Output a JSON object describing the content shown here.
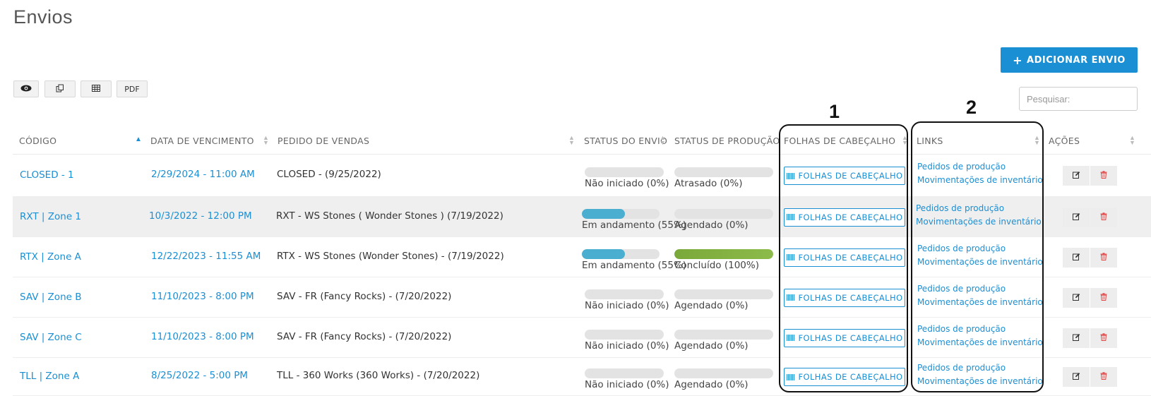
{
  "page": {
    "title": "Envios"
  },
  "toolbar": {
    "add_label": "ADICIONAR ENVIO",
    "add_icon": "plus-icon",
    "pdf_label": "PDF",
    "search_placeholder": "Pesquisar:"
  },
  "columns": {
    "codigo": "CÓDIGO",
    "data": "DATA DE VENCIMENTO",
    "pedido": "PEDIDO DE VENDAS",
    "status_envio": "STATUS DO ENVIO",
    "status_producao": "STATUS DE PRODUÇÃO",
    "folhas": "FOLHAS DE CABEÇALHO",
    "links": "LINKS",
    "acoes": "AÇÕES"
  },
  "common": {
    "folhas_label": "FOLHAS DE CABEÇALHO",
    "link_pedidos": "Pedidos de produção",
    "link_movimentacoes": "Movimentações de inventário"
  },
  "rows": [
    {
      "code": "CLOSED - 1",
      "date": "2/29/2024 - 11:00 AM",
      "order": "CLOSED - (9/25/2022)",
      "envio_label": "Não iniciado (0%)",
      "envio_pct": 0,
      "prod_label": "Atrasado (0%)",
      "prod_pct": 0
    },
    {
      "code": "RXT | Zone 1",
      "date": "10/3/2022 - 12:00 PM",
      "order": "RXT - WS Stones ( Wonder Stones ) (7/19/2022)",
      "envio_label": "Em andamento (55%)",
      "envio_pct": 55,
      "prod_label": "Agendado (0%)",
      "prod_pct": 0
    },
    {
      "code": "RTX | Zone A",
      "date": "12/22/2023 - 11:55 AM",
      "order": "RTX - WS Stones (Wonder Stones) - (7/19/2022)",
      "envio_label": "Em andamento (55%)",
      "envio_pct": 55,
      "prod_label": "Concluído (100%)",
      "prod_pct": 100
    },
    {
      "code": "SAV | Zone B",
      "date": "11/10/2023 - 8:00 PM",
      "order": "SAV - FR (Fancy Rocks) - (7/20/2022)",
      "envio_label": "Não iniciado (0%)",
      "envio_pct": 0,
      "prod_label": "Agendado (0%)",
      "prod_pct": 0
    },
    {
      "code": "SAV | Zone C",
      "date": "11/10/2023 - 8:00 PM",
      "order": "SAV - FR (Fancy Rocks) - (7/20/2022)",
      "envio_label": "Não iniciado (0%)",
      "envio_pct": 0,
      "prod_label": "Agendado (0%)",
      "prod_pct": 0
    },
    {
      "code": "TLL | Zone A",
      "date": "8/25/2022 - 5:00 PM",
      "order": "TLL - 360 Works (360 Works) - (7/20/2022)",
      "envio_label": "Não iniciado (0%)",
      "envio_pct": 0,
      "prod_label": "Agendado (0%)",
      "prod_pct": 0
    }
  ],
  "annotations": {
    "one": "1",
    "two": "2"
  },
  "colors": {
    "accent": "#1a8fd4",
    "envio_fill": "#4aaed0",
    "producao_fill": "#8cbb4a",
    "danger": "#e04848"
  }
}
